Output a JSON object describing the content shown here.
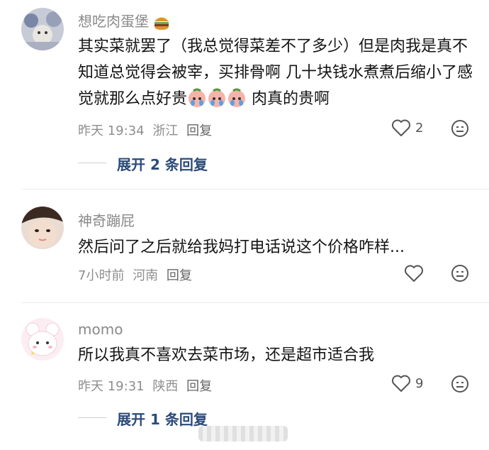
{
  "comments": [
    {
      "username": "想吃肉蛋堡",
      "username_emoji": "hamburger-icon",
      "text_part1": "其实菜就罢了（我总觉得菜差不了多少）但是肉我是真不知道总觉得会被宰，买排骨啊 几十块钱水煮煮后缩小了感觉就那么点好贵",
      "text_part2": "肉真的贵啊",
      "time": "昨天 19:34",
      "location": "浙江",
      "reply_label": "回复",
      "likes": "2",
      "expand_label": "展开 2 条回复"
    },
    {
      "username": "神奇蹦屁",
      "text": "然后问了之后就给我妈打电话说这个价格咋样...",
      "time": "7小时前",
      "location": "河南",
      "reply_label": "回复",
      "likes": ""
    },
    {
      "username": "momo",
      "text": "所以我真不喜欢去菜市场，还是超市适合我",
      "time": "昨天 19:31",
      "location": "陕西",
      "reply_label": "回复",
      "likes": "9",
      "expand_label": "展开 1 条回复"
    }
  ],
  "colors": {
    "username": "#8a8a8a",
    "meta": "#8e8e8e",
    "expand": "#2b4a78"
  }
}
